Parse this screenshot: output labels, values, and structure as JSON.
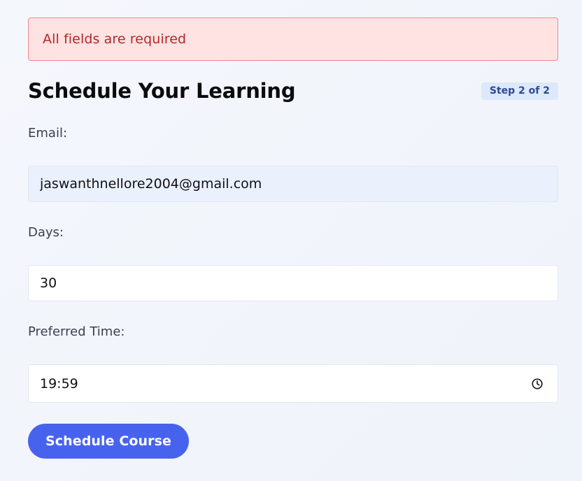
{
  "alert": {
    "message": "All fields are required",
    "color": "#b62727",
    "background": "#ffe2e2"
  },
  "header": {
    "title": "Schedule Your Learning",
    "step_badge": "Step 2 of 2"
  },
  "form": {
    "email": {
      "label": "Email:",
      "value": "jaswanthnellore2004@gmail.com"
    },
    "days": {
      "label": "Days:",
      "value": "30"
    },
    "preferred_time": {
      "label": "Preferred Time:",
      "value": "19:59",
      "icon": "clock-icon"
    },
    "submit_label": "Schedule Course"
  },
  "colors": {
    "accent": "#4763ee",
    "badge_bg": "#dde8fb",
    "badge_text": "#2c4a94"
  }
}
